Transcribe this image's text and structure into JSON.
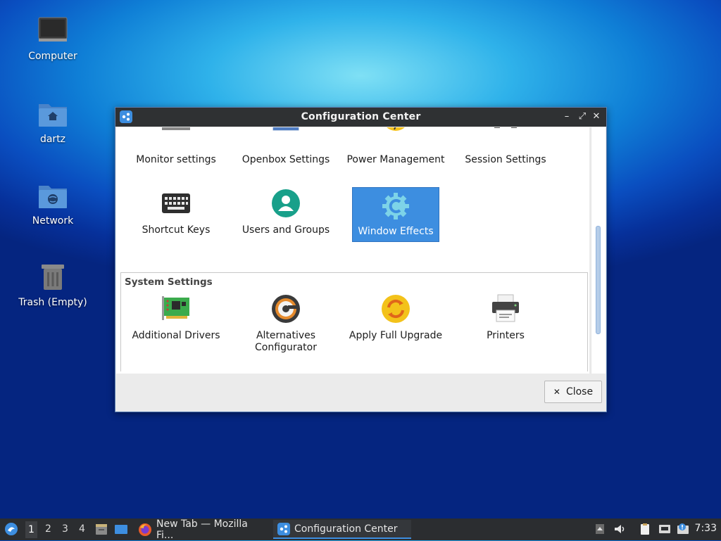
{
  "desktop": {
    "icons": [
      {
        "label": "Computer"
      },
      {
        "label": "dartz"
      },
      {
        "label": "Network"
      },
      {
        "label": "Trash (Empty)"
      }
    ]
  },
  "window": {
    "title": "Configuration Center",
    "controls": {
      "minimize": "–",
      "maximize": "⤢",
      "close": "✕"
    },
    "partial_row": [
      {
        "label": "Monitor settings",
        "icon": "monitor-icon"
      },
      {
        "label": "Openbox Settings",
        "icon": "openbox-icon"
      },
      {
        "label": "Power Management",
        "icon": "power-icon"
      },
      {
        "label": "Session Settings",
        "icon": "session-gear-icon"
      }
    ],
    "row2": [
      {
        "label": "Shortcut Keys",
        "icon": "keyboard-icon"
      },
      {
        "label": "Users and Groups",
        "icon": "users-icon"
      },
      {
        "label": "Window Effects",
        "icon": "compton-icon",
        "selected": true
      }
    ],
    "system_group": {
      "title": "System Settings",
      "items": [
        {
          "label": "Additional Drivers",
          "icon": "pci-card-icon"
        },
        {
          "label": "Alternatives Configurator",
          "icon": "alternatives-icon"
        },
        {
          "label": "Apply Full Upgrade",
          "icon": "upgrade-icon"
        },
        {
          "label": "Printers",
          "icon": "printer-icon"
        }
      ]
    },
    "close_button": {
      "label": "Close",
      "glyph": "✕"
    }
  },
  "taskbar": {
    "workspaces": [
      "1",
      "2",
      "3",
      "4"
    ],
    "active_workspace": "1",
    "tasks": [
      {
        "label": "New Tab — Mozilla Fi...",
        "icon": "firefox-icon"
      },
      {
        "label": "Configuration Center",
        "icon": "config-center-icon",
        "active": true
      }
    ],
    "clock": "7:33"
  },
  "colors": {
    "selection": "#3d8ee0",
    "titlebar": "#2f3133",
    "taskbar": "#2b2d30"
  }
}
